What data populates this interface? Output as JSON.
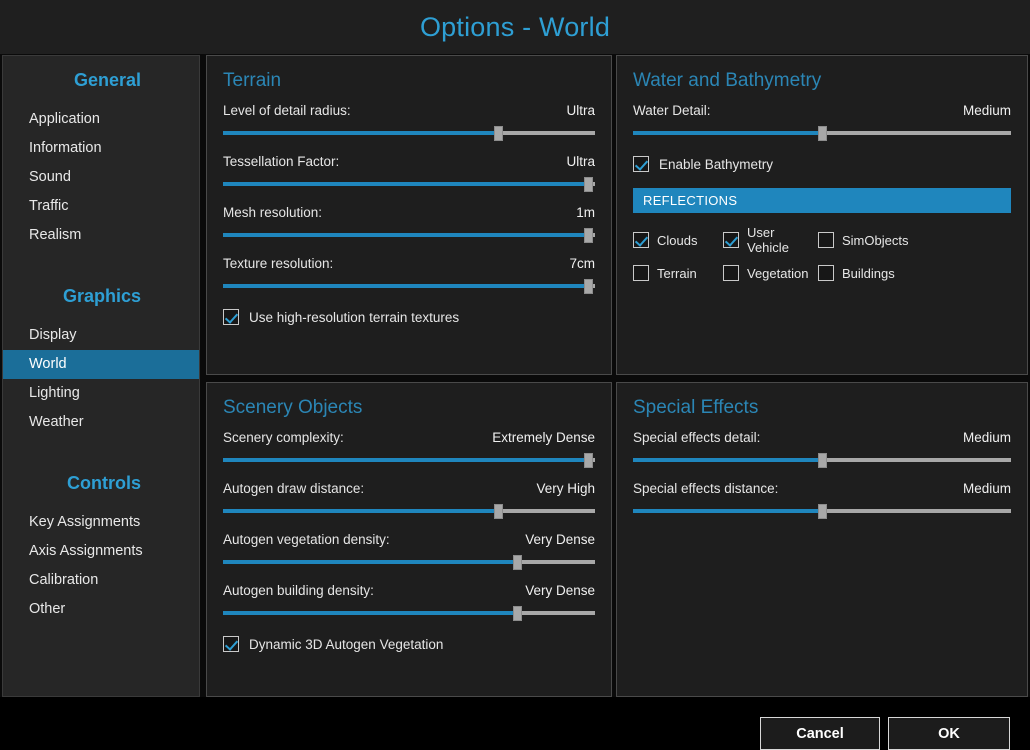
{
  "window": {
    "title": "Options - World"
  },
  "colors": {
    "accent": "#2e9fd4",
    "panel_title": "#2b86b5",
    "slider_fill": "#1f86bd",
    "slider_track": "#a8a8a8",
    "selection": "#1b6e99",
    "section_bar": "#1f86bd",
    "panel_bg": "#1e1e1e",
    "sidebar_bg": "#262626"
  },
  "sidebar": {
    "groups": [
      {
        "header": "General",
        "items": [
          {
            "label": "Application",
            "selected": false
          },
          {
            "label": "Information",
            "selected": false
          },
          {
            "label": "Sound",
            "selected": false
          },
          {
            "label": "Traffic",
            "selected": false
          },
          {
            "label": "Realism",
            "selected": false
          }
        ]
      },
      {
        "header": "Graphics",
        "items": [
          {
            "label": "Display",
            "selected": false
          },
          {
            "label": "World",
            "selected": true
          },
          {
            "label": "Lighting",
            "selected": false
          },
          {
            "label": "Weather",
            "selected": false
          }
        ]
      },
      {
        "header": "Controls",
        "items": [
          {
            "label": "Key Assignments",
            "selected": false
          },
          {
            "label": "Axis Assignments",
            "selected": false
          },
          {
            "label": "Calibration",
            "selected": false
          },
          {
            "label": "Other",
            "selected": false
          }
        ]
      }
    ]
  },
  "panels": {
    "terrain": {
      "title": "Terrain",
      "sliders": [
        {
          "label": "Level of detail radius:",
          "value": "Ultra",
          "percent": 74
        },
        {
          "label": "Tessellation Factor:",
          "value": "Ultra",
          "percent": 98
        },
        {
          "label": "Mesh resolution:",
          "value": "1m",
          "percent": 98
        },
        {
          "label": "Texture resolution:",
          "value": "7cm",
          "percent": 98
        }
      ],
      "checkboxes": [
        {
          "label": "Use high-resolution terrain textures",
          "checked": true
        }
      ]
    },
    "water": {
      "title": "Water and Bathymetry",
      "sliders": [
        {
          "label": "Water Detail:",
          "value": "Medium",
          "percent": 50
        }
      ],
      "checkboxes": [
        {
          "label": "Enable Bathymetry",
          "checked": true
        }
      ],
      "section": {
        "title": "REFLECTIONS",
        "options": [
          {
            "label": "Clouds",
            "checked": true
          },
          {
            "label": "User Vehicle",
            "checked": true
          },
          {
            "label": "SimObjects",
            "checked": false
          },
          {
            "label": "Terrain",
            "checked": false
          },
          {
            "label": "Vegetation",
            "checked": false
          },
          {
            "label": "Buildings",
            "checked": false
          }
        ]
      }
    },
    "scenery": {
      "title": "Scenery Objects",
      "sliders": [
        {
          "label": "Scenery complexity:",
          "value": "Extremely Dense",
          "percent": 98
        },
        {
          "label": "Autogen draw distance:",
          "value": "Very High",
          "percent": 74
        },
        {
          "label": "Autogen vegetation density:",
          "value": "Very Dense",
          "percent": 79
        },
        {
          "label": "Autogen building density:",
          "value": "Very Dense",
          "percent": 79
        }
      ],
      "checkboxes": [
        {
          "label": "Dynamic 3D Autogen Vegetation",
          "checked": true
        }
      ]
    },
    "effects": {
      "title": "Special Effects",
      "sliders": [
        {
          "label": "Special effects detail:",
          "value": "Medium",
          "percent": 50
        },
        {
          "label": "Special effects distance:",
          "value": "Medium",
          "percent": 50
        }
      ]
    }
  },
  "footer": {
    "cancel_label": "Cancel",
    "ok_label": "OK"
  }
}
